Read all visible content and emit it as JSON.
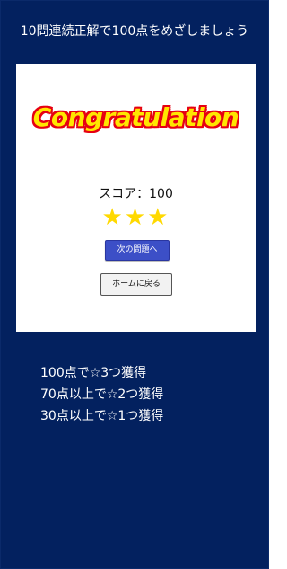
{
  "header": {
    "title": "10問連続正解で100点をめざしましょう"
  },
  "result_card": {
    "congrats_text": "Congratulation",
    "score_text": "スコア：100",
    "stars_earned": 3,
    "stars_total": 3,
    "next_button_label": "次の問題へ",
    "home_button_label": "ホームに戻る"
  },
  "rules": {
    "lines": [
      "100点で☆3つ獲得",
      "70点以上で☆2つ獲得",
      "30点以上で☆1つ獲得"
    ]
  },
  "colors": {
    "background": "#03215f",
    "card": "#ffffff",
    "congrats_fill": "#ffe600",
    "congrats_outline": "#e60012",
    "star": "#ffd900",
    "next_button": "#3c4fc7"
  }
}
